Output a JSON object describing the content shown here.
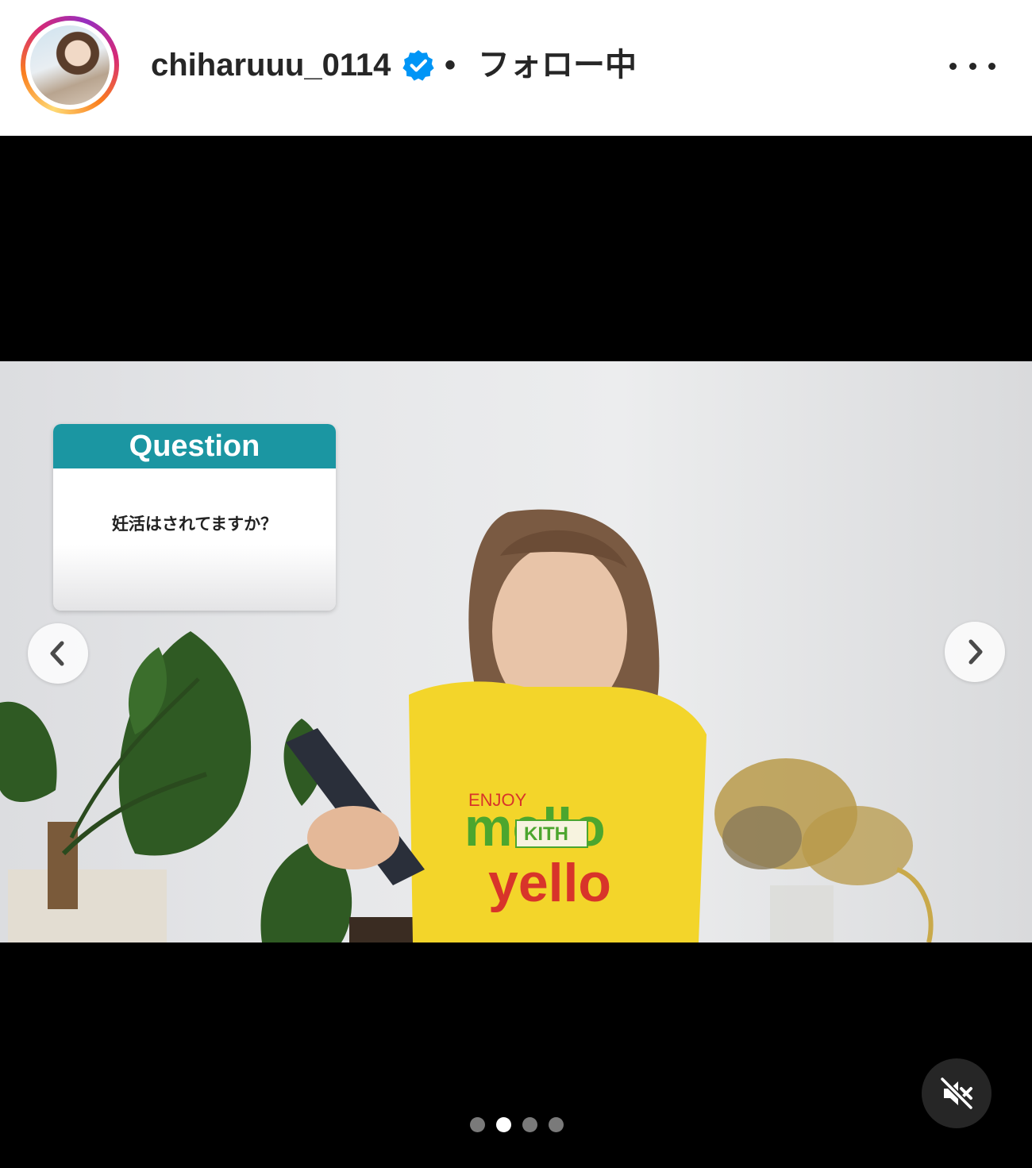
{
  "header": {
    "username": "chiharuuu_0114",
    "separator": "•",
    "follow_status": "フォロー中",
    "verified_icon": "verified-badge-icon",
    "more_icon": "more-options-icon"
  },
  "post": {
    "question_card": {
      "title": "Question",
      "text": "妊活はされてますか？"
    },
    "shirt_text": {
      "line1": "ENJOY",
      "line2": "mello",
      "line3": "KITH",
      "line4": "yello"
    },
    "carousel": {
      "slide_count": 4,
      "active_index": 1
    },
    "controls": {
      "prev_icon": "chevron-left-icon",
      "next_icon": "chevron-right-icon",
      "mute_icon": "muted-speaker-icon"
    }
  },
  "colors": {
    "verified_blue": "#0095f6",
    "question_header": "#1b96a2",
    "text_primary": "#262626"
  }
}
